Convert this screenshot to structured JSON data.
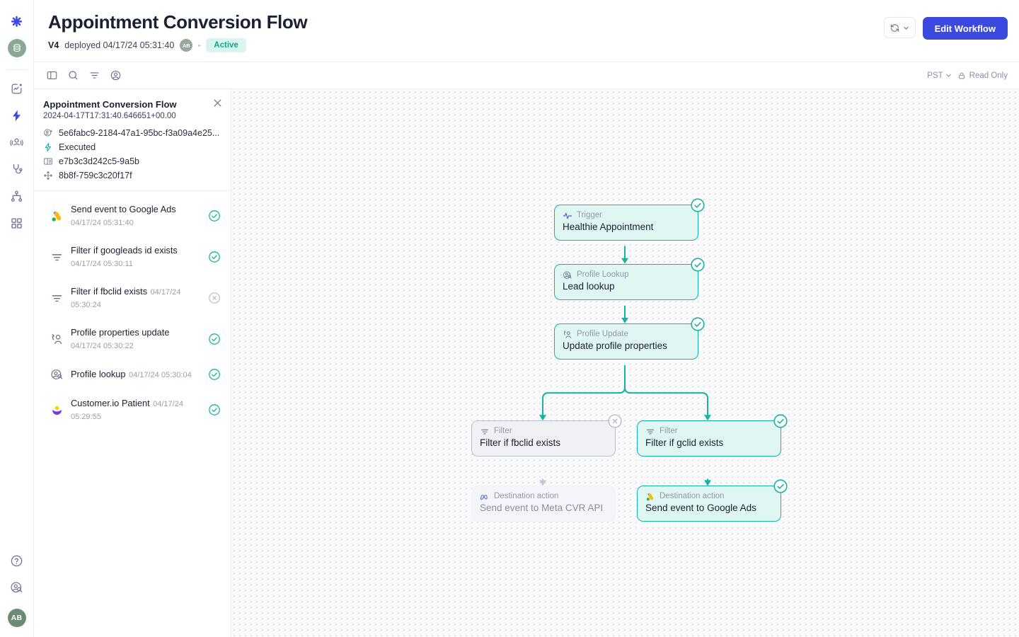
{
  "rail": {
    "items": [
      {
        "name": "logo-asterisk-icon",
        "label": "Customer.io"
      },
      {
        "name": "data-warehouse-icon",
        "label": "Data"
      },
      {
        "name": "analytics-icon",
        "label": "Analytics"
      },
      {
        "name": "journeys-lightning-icon",
        "label": "Journeys"
      },
      {
        "name": "audience-people-icon",
        "label": "Audience"
      },
      {
        "name": "stethoscope-icon",
        "label": "Health"
      },
      {
        "name": "workflow-nodes-icon",
        "label": "Workflows"
      },
      {
        "name": "grid-apps-icon",
        "label": "Apps"
      }
    ],
    "bottom": [
      {
        "name": "help-circle-icon",
        "label": "Help"
      },
      {
        "name": "profile-search-icon",
        "label": "Profile lookup"
      }
    ],
    "avatar": "AB"
  },
  "header": {
    "title": "Appointment Conversion Flow",
    "version": "V4",
    "deployed_text": "deployed 04/17/24 05:31:40",
    "avatar": "AB",
    "status_badge": "Active",
    "refresh_label": "Refresh",
    "edit_button": "Edit Workflow"
  },
  "toolbar": {
    "left_icons": [
      {
        "name": "panel-toggle-icon"
      },
      {
        "name": "search-icon"
      },
      {
        "name": "filter-icon"
      },
      {
        "name": "profile-icon"
      }
    ],
    "timezone": "PST",
    "read_only": "Read Only"
  },
  "run_panel": {
    "title": "Appointment Conversion Flow",
    "timestamp": "2024-04-17T17:31:40.646651+00.00",
    "meta": [
      {
        "icon": "profile-search-icon",
        "value": "5e6fabc9-2184-47a1-95bc-f3a09a4e25..."
      },
      {
        "icon": "lightning-icon",
        "value": "Executed"
      },
      {
        "icon": "id-card-icon",
        "value": "e7b3c3d242c5-9a5b"
      },
      {
        "icon": "move-crosshair-icon",
        "value": "8b8f-759c3c20f17f"
      }
    ],
    "items": [
      {
        "icon": "google-ads-icon",
        "name": "Send event to Google Ads",
        "time": "04/17/24 05:31:40",
        "status": "success"
      },
      {
        "icon": "filter-icon",
        "name": "Filter if googleads id exists",
        "time": "04/17/24 05:30:11",
        "status": "success"
      },
      {
        "icon": "filter-icon",
        "name": "Filter if fbclid exists",
        "time": "04/17/24 05:30:24",
        "status": "skipped"
      },
      {
        "icon": "profile-update-icon",
        "name": "Profile properties update",
        "time": "04/17/24 05:30:22",
        "status": "success"
      },
      {
        "icon": "profile-lookup-icon",
        "name": "Profile lookup",
        "time": "04/17/24 05:30:04",
        "status": "success"
      },
      {
        "icon": "customerio-icon",
        "name": "Customer.io Patient",
        "time": "04/17/24 05:29:55",
        "status": "success"
      }
    ]
  },
  "flow": {
    "nodes": [
      {
        "id": "trigger",
        "kind": "Trigger",
        "kind_icon": "pulse-icon",
        "label": "Healthie Appointment",
        "state": "success"
      },
      {
        "id": "lookup",
        "kind": "Profile Lookup",
        "kind_icon": "profile-lookup-icon",
        "label": "Lead lookup",
        "state": "success"
      },
      {
        "id": "update",
        "kind": "Profile Update",
        "kind_icon": "profile-update-icon",
        "label": "Update profile properties",
        "state": "success"
      },
      {
        "id": "filter_fb",
        "kind": "Filter",
        "kind_icon": "filter-icon",
        "label": "Filter if fbclid exists",
        "state": "skipped"
      },
      {
        "id": "filter_g",
        "kind": "Filter",
        "kind_icon": "filter-icon",
        "label": "Filter if gclid exists",
        "state": "success"
      },
      {
        "id": "meta_dest",
        "kind": "Destination action",
        "kind_icon": "meta-icon",
        "label": "Send event to Meta CVR API",
        "state": "ghost"
      },
      {
        "id": "gads_dest",
        "kind": "Destination action",
        "kind_icon": "google-ads-icon",
        "label": "Send event to Google Ads",
        "state": "success"
      }
    ]
  },
  "colors": {
    "accent_blue": "#3b49df",
    "teal": "#17b3a3",
    "teal_fill": "#dff6f2",
    "muted": "#b9bdcc",
    "text_dark": "#1b2033"
  }
}
